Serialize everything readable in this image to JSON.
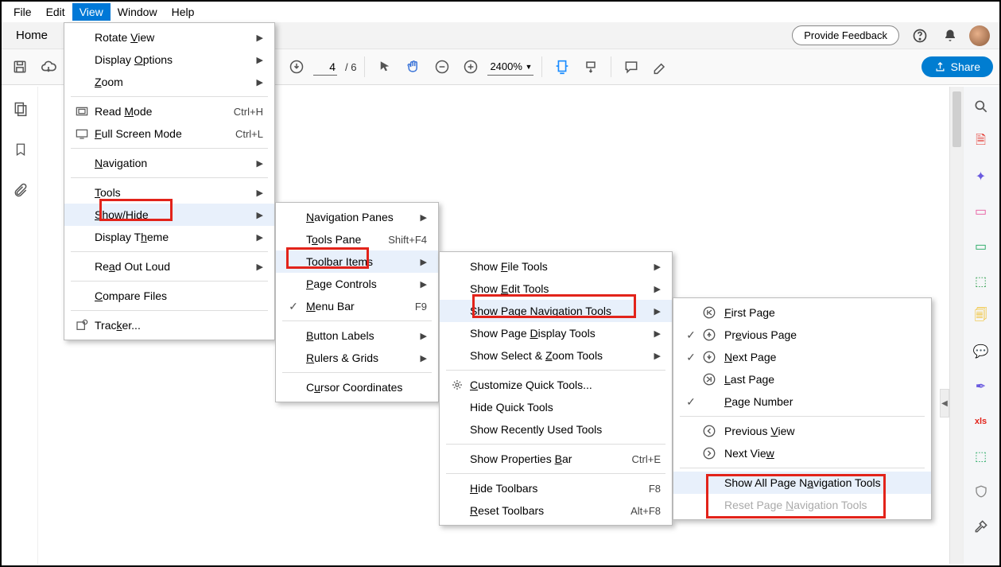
{
  "menubar": {
    "file": "File",
    "edit": "Edit",
    "view": "View",
    "window": "Window",
    "help": "Help"
  },
  "titlerow": {
    "home": "Home",
    "feedback": "Provide Feedback"
  },
  "toolbar": {
    "page_current": "4",
    "page_total": "/ 6",
    "zoom": "2400%",
    "share": "Share"
  },
  "view_menu": {
    "rotate": "Rotate View",
    "display_options": "Display Options",
    "zoom": "Zoom",
    "read_mode": "Read Mode",
    "read_mode_k": "Ctrl+H",
    "full_screen": "Full Screen Mode",
    "full_screen_k": "Ctrl+L",
    "navigation": "Navigation",
    "tools": "Tools",
    "show_hide": "Show/Hide",
    "display_theme": "Display Theme",
    "read_out": "Read Out Loud",
    "compare": "Compare Files",
    "tracker": "Tracker..."
  },
  "showhide_menu": {
    "nav_panes": "Navigation Panes",
    "tools_pane": "Tools Pane",
    "tools_pane_k": "Shift+F4",
    "toolbar_items": "Toolbar Items",
    "page_controls": "Page Controls",
    "menu_bar": "Menu Bar",
    "menu_bar_k": "F9",
    "button_labels": "Button Labels",
    "rulers": "Rulers & Grids",
    "cursor": "Cursor Coordinates"
  },
  "toolbar_items_menu": {
    "file_tools": "Show File Tools",
    "edit_tools": "Show Edit Tools",
    "nav_tools": "Show Page Navigation Tools",
    "display_tools": "Show Page Display Tools",
    "zoom_tools": "Show Select & Zoom Tools",
    "customize": "Customize Quick Tools...",
    "hide_quick": "Hide Quick Tools",
    "recent": "Show Recently Used Tools",
    "prop_bar": "Show Properties Bar",
    "prop_bar_k": "Ctrl+E",
    "hide_tb": "Hide Toolbars",
    "hide_tb_k": "F8",
    "reset_tb": "Reset Toolbars",
    "reset_tb_k": "Alt+F8"
  },
  "nav_tools_menu": {
    "first": "First Page",
    "prev": "Previous Page",
    "next": "Next Page",
    "last": "Last Page",
    "page_num": "Page Number",
    "prev_view": "Previous View",
    "next_view": "Next View",
    "show_all": "Show All Page Navigation Tools",
    "reset": "Reset Page Navigation Tools"
  }
}
